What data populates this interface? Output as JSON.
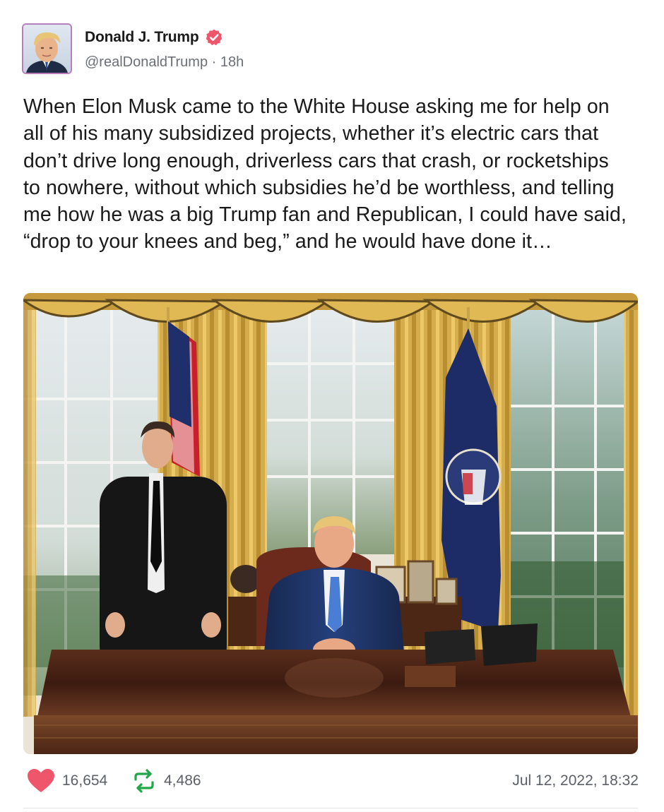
{
  "author": {
    "display_name": "Donald J. Trump",
    "handle": "@realDonaldTrump",
    "separator": "·",
    "age": "18h",
    "verified_icon": "verified-badge-icon",
    "verified_color": "#f0566b",
    "avatar_icon": "avatar-portrait"
  },
  "post": {
    "text": "When Elon Musk came to the White House asking me for help on all of his many subsidized projects, whether it’s electric cars that don’t drive long enough, driverless cars that crash, or rocketships to nowhere, without which subsidies he’d be worthless, and telling me how he was a big Trump fan and Republican, I could have said, “drop to your knees and beg,” and he would have done it…",
    "image_icon": "oval-office-photo"
  },
  "stats": {
    "likes": "16,654",
    "reposts": "4,486",
    "like_icon": "heart-icon",
    "like_color": "#f0566b",
    "repost_icon": "repost-icon",
    "repost_color": "#22a64a"
  },
  "timestamp": "Jul 12, 2022, 18:32"
}
